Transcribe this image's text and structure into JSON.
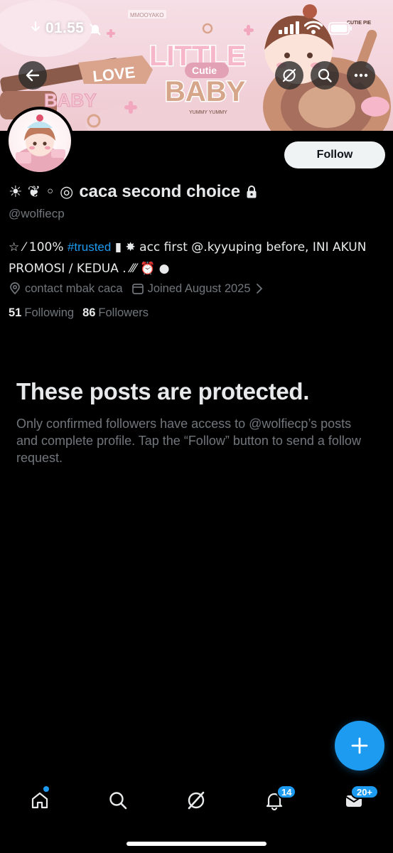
{
  "status_bar": {
    "time": "01.55"
  },
  "banner": {
    "title_line1": "LITTLE",
    "title_line2": "Cutie",
    "title_line3": "BABY",
    "love_text": "LOVE",
    "baby_text": "BABY",
    "yummy_text": "YUMMY YUMMY",
    "cutie_text": "CUTIE PIE",
    "small_tag": "MMOOYAKO"
  },
  "header_actions": {
    "back_icon": "arrow-left-icon",
    "grok_icon": "grok-icon",
    "search_icon": "search-icon",
    "more_icon": "more-horizontal-icon"
  },
  "profile": {
    "name_prefix": "☀ ❦ ◦ ◎",
    "display_name": "caca second choice",
    "handle": "@wolfiecp",
    "follow_label": "Follow",
    "bio": {
      "part1": "☆ ⁄ 100% ",
      "hashtag": "#trusted",
      "part2": " ▮  ✸  acc first @.kyyuping before, INI AKUN PROMOSI / KEDUA . ⁄⁄⁄ ⏰ ●"
    },
    "location": "contact mbak caca",
    "joined": "Joined August 2025",
    "following_count": "51",
    "following_label": "Following",
    "followers_count": "86",
    "followers_label": "Followers"
  },
  "protected": {
    "title": "These posts are protected.",
    "body": "Only confirmed followers have access to @wolfiecp’s posts and complete profile. Tap the “Follow” button to send a follow request."
  },
  "fab": {
    "icon": "plus-icon"
  },
  "bottom_nav": {
    "notifications_badge": "14",
    "messages_badge": "20+"
  },
  "colors": {
    "accent": "#1d9bf0",
    "background": "#000000",
    "text_primary": "#e7e9ea",
    "text_secondary": "#71767b"
  }
}
